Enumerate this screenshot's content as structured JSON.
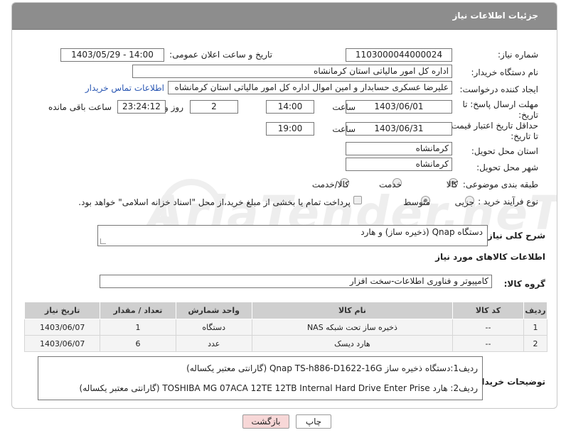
{
  "header": {
    "title": "جزئیات اطلاعات نیاز"
  },
  "form": {
    "need_number_label": "شماره نیاز:",
    "need_number": "1103000044000024",
    "announce_label": "تاریخ و ساعت اعلان عمومی:",
    "announce_value": "1403/05/29 - 14:00",
    "buyer_org_label": "نام دستگاه خریدار:",
    "buyer_org": "اداره کل امور مالیاتی استان کرمانشاه",
    "creator_label": "ایجاد کننده درخواست:",
    "creator": "علیرضا عسکری حسابدار و امین اموال اداره کل امور مالیاتی استان کرمانشاه",
    "contact_link": "اطلاعات تماس خریدار",
    "send_deadline_label": "مهلت ارسال پاسخ: تا تاریخ:",
    "send_date": "1403/06/01",
    "time_label": "ساعت",
    "send_time": "14:00",
    "days_value": "2",
    "days_label": "روز و",
    "remaining_time": "23:24:12",
    "remaining_label": "ساعت باقی مانده",
    "price_validity_label": "حداقل تاریخ اعتبار قیمت: تا تاریخ:",
    "price_date": "1403/06/31",
    "price_time": "19:00",
    "province_label": "استان محل تحویل:",
    "province": "کرمانشاه",
    "city_label": "شهر محل تحویل:",
    "city": "کرمانشاه",
    "category_label": "طبقه بندی موضوعی:",
    "category_options": [
      "کالا",
      "خدمت",
      "کالا/خدمت"
    ],
    "category_selected": "کالا",
    "process_label": "نوع فرآیند خرید :",
    "process_options": [
      "جزیی",
      "متوسط"
    ],
    "process_selected": "متوسط",
    "payment_note": "پرداخت تمام یا بخشی از مبلغ خرید،از محل \"اسناد خزانه اسلامی\" خواهد بود."
  },
  "description": {
    "label": "شرح کلی نیاز:",
    "value": "دستگاه Qnap (ذخیره ساز) و هارد"
  },
  "goods": {
    "section_title": "اطلاعات کالاهای مورد نیاز",
    "group_label": "گروه کالا:",
    "group_value": "کامپیوتر و فناوری اطلاعات-سخت افزار",
    "columns": [
      "ردیف",
      "کد کالا",
      "نام کالا",
      "واحد شمارش",
      "تعداد / مقدار",
      "تاریخ نیاز"
    ],
    "rows": [
      {
        "index": "1",
        "code": "--",
        "name": "ذخیره ساز تحت شبکه NAS",
        "unit": "دستگاه",
        "qty": "1",
        "date": "1403/06/07"
      },
      {
        "index": "2",
        "code": "--",
        "name": "هارد دیسک",
        "unit": "عدد",
        "qty": "6",
        "date": "1403/06/07"
      }
    ]
  },
  "buyer_notes": {
    "label": "توضیحات خریدار:",
    "line1": "ردیف1:دستگاه ذخیره ساز   Qnap TS-h886-D1622-16G   (گارانتی معتبر یکساله)",
    "line2": "ردیف2: هارد TOSHIBA MG 07ACA 12TE 12TB Internal Hard Drive Enter Prise (گارانتی معتبر یکساله)"
  },
  "buttons": {
    "print": "چاپ",
    "back": "بازگشت"
  },
  "watermark": "AriaTender.neT",
  "colors": {
    "header_bg": "#8d8d8d",
    "link": "#2a57b3",
    "back_btn_bg": "#f7d7d7",
    "print_btn_bg": "#ffffff"
  }
}
